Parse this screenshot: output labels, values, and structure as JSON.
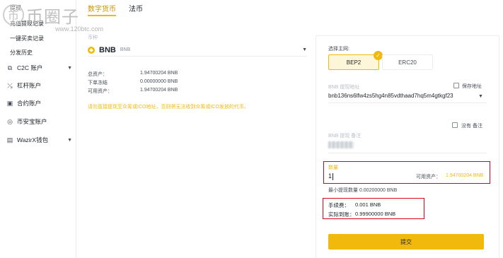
{
  "watermark": {
    "glyph": "币",
    "text": "币圈子",
    "url": "www.120btc.com"
  },
  "sidebar": {
    "links": [
      {
        "label": "提现"
      },
      {
        "label": "充值提现记录"
      },
      {
        "label": "一键买卖记录"
      },
      {
        "label": "分发历史"
      }
    ],
    "items": [
      {
        "label": "C2C 账户",
        "icon": "people-icon",
        "glyph": "⧉",
        "caret": "▼"
      },
      {
        "label": "杠杆账户",
        "icon": "margin-icon",
        "glyph": "⤯",
        "caret": ""
      },
      {
        "label": "合约账户",
        "icon": "futures-icon",
        "glyph": "▣",
        "caret": ""
      },
      {
        "label": "币安宝账户",
        "icon": "savings-icon",
        "glyph": "◎",
        "caret": ""
      },
      {
        "label": "WazirX钱包",
        "icon": "wallet-icon",
        "glyph": "▤",
        "caret": "▼"
      }
    ]
  },
  "tabs": {
    "crypto": "数字货币",
    "fiat": "法币"
  },
  "coin": {
    "label": "币种",
    "symbol": "BNB",
    "name": "BNB",
    "caret": "▼"
  },
  "balances": [
    {
      "key": "总资产：",
      "value": "1.94700204 BNB"
    },
    {
      "key": "下单冻结",
      "value": "0.00000000 BNB"
    },
    {
      "key": "可用资产：",
      "value": "1.94700204 BNB"
    }
  ],
  "notice": "请勿直接提现至众筹或ICO地址，否则将无法收到众筹或ICO发放的代币。",
  "form": {
    "network_label": "选择主网:",
    "networks": [
      {
        "label": "BEP2",
        "selected": true
      },
      {
        "label": "ERC20",
        "selected": false
      }
    ],
    "check_glyph": "✓",
    "address_label": "BNB 提现地址",
    "save_address": "保存地址",
    "address_value": "bnb136ns6lfw4zs5hg4n85vdthaad7hq5m4gtkgf23",
    "address_caret": "▼",
    "no_memo": "没有 备注",
    "memo_label": "BNB 提现 备注",
    "amount_label": "数量",
    "amount_value": "1",
    "available_label": "可用资产：",
    "available_value": "1.94700204 BNB",
    "min_amount": "最小提现数量 0.00200000 BNB",
    "fee_label": "手续费：",
    "fee_value": "0.001 BNB",
    "receive_label": "实际到账：",
    "receive_value": "0.99900000 BNB",
    "submit": "提交"
  },
  "colors": {
    "accent": "#f0b90b",
    "highlight_box": "#d9001b"
  }
}
